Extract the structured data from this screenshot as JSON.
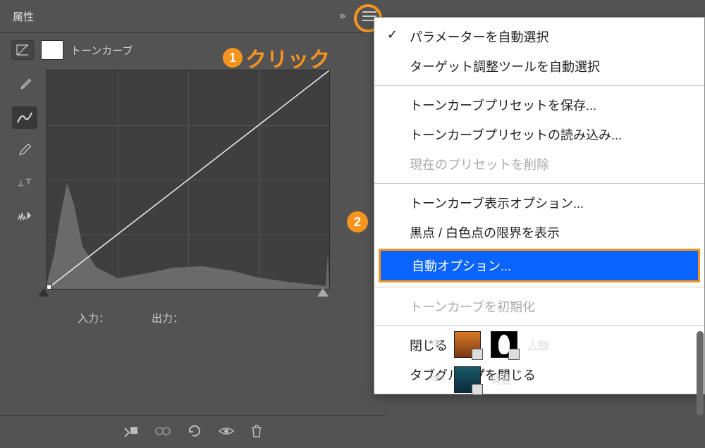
{
  "panel": {
    "title": "属性",
    "adjustment_label": "トーンカーブ"
  },
  "annotations": {
    "click_label": "クリック",
    "step1": "1",
    "step2": "2"
  },
  "io": {
    "input_label": "入力：",
    "output_label": "出力："
  },
  "menu": {
    "items": [
      {
        "label": "パラメーターを自動選択",
        "checked": true
      },
      {
        "label": "ターゲット調整ツールを自動選択"
      }
    ],
    "group2": [
      {
        "label": "トーンカーブプリセットを保存..."
      },
      {
        "label": "トーンカーブプリセットの読み込み..."
      },
      {
        "label": "現在のプリセットを削除",
        "disabled": true
      }
    ],
    "group3": [
      {
        "label": "トーンカーブ表示オプション..."
      },
      {
        "label": "黒点 / 白色点の限界を表示"
      },
      {
        "label": "自動オプション...",
        "highlighted": true
      }
    ],
    "group4": [
      {
        "label": "トーンカーブを初期化",
        "disabled": true
      }
    ],
    "group5": [
      {
        "label": "閉じる"
      },
      {
        "label": "タブグループを閉じる"
      }
    ]
  },
  "layers": {
    "layer1_name": "人物",
    "layer2_name": "背景"
  },
  "icons": {
    "eyedropper": "eyedropper",
    "curve": "curve",
    "pencil": "pencil",
    "sliders": "sliders",
    "histogram": "histogram"
  }
}
